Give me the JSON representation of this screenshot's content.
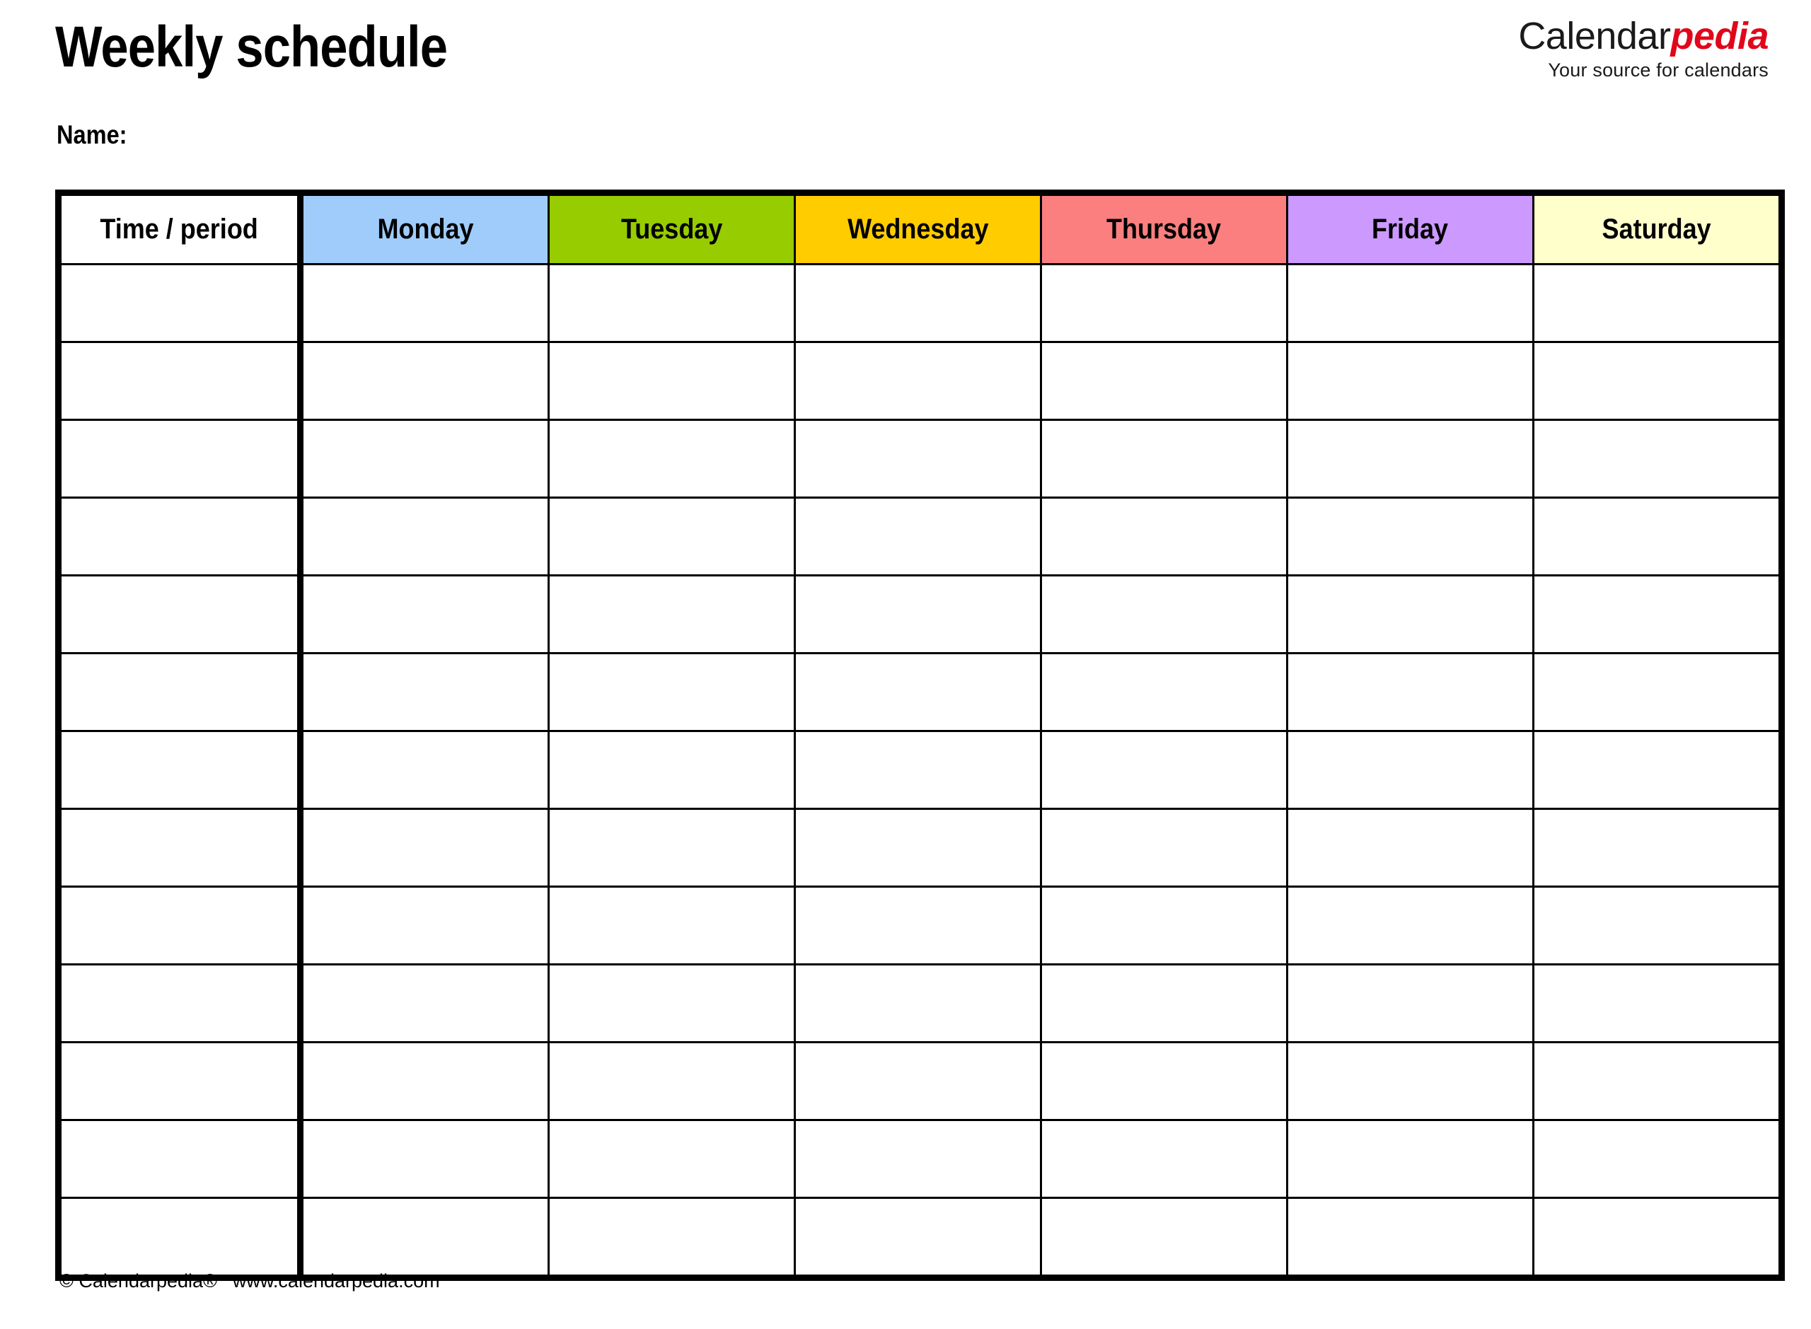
{
  "document": {
    "title": "Weekly schedule",
    "name_label": "Name:"
  },
  "brand": {
    "word_part1": "Calendar",
    "word_part2": "pedia",
    "tagline": "Your source for calendars",
    "accent_color": "#e1071b"
  },
  "table": {
    "columns": [
      {
        "label": "Time / period",
        "bg": "#ffffff",
        "key": "time"
      },
      {
        "label": "Monday",
        "bg": "#9fccfa",
        "key": "monday"
      },
      {
        "label": "Tuesday",
        "bg": "#97cc00",
        "key": "tuesday"
      },
      {
        "label": "Wednesday",
        "bg": "#ffcc00",
        "key": "wednesday"
      },
      {
        "label": "Thursday",
        "bg": "#fb7f7f",
        "key": "thursday"
      },
      {
        "label": "Friday",
        "bg": "#cc99ff",
        "key": "friday"
      },
      {
        "label": "Saturday",
        "bg": "#ffffcc",
        "key": "saturday"
      }
    ],
    "row_count": 13,
    "rows": [
      {
        "time": "",
        "monday": "",
        "tuesday": "",
        "wednesday": "",
        "thursday": "",
        "friday": "",
        "saturday": ""
      },
      {
        "time": "",
        "monday": "",
        "tuesday": "",
        "wednesday": "",
        "thursday": "",
        "friday": "",
        "saturday": ""
      },
      {
        "time": "",
        "monday": "",
        "tuesday": "",
        "wednesday": "",
        "thursday": "",
        "friday": "",
        "saturday": ""
      },
      {
        "time": "",
        "monday": "",
        "tuesday": "",
        "wednesday": "",
        "thursday": "",
        "friday": "",
        "saturday": ""
      },
      {
        "time": "",
        "monday": "",
        "tuesday": "",
        "wednesday": "",
        "thursday": "",
        "friday": "",
        "saturday": ""
      },
      {
        "time": "",
        "monday": "",
        "tuesday": "",
        "wednesday": "",
        "thursday": "",
        "friday": "",
        "saturday": ""
      },
      {
        "time": "",
        "monday": "",
        "tuesday": "",
        "wednesday": "",
        "thursday": "",
        "friday": "",
        "saturday": ""
      },
      {
        "time": "",
        "monday": "",
        "tuesday": "",
        "wednesday": "",
        "thursday": "",
        "friday": "",
        "saturday": ""
      },
      {
        "time": "",
        "monday": "",
        "tuesday": "",
        "wednesday": "",
        "thursday": "",
        "friday": "",
        "saturday": ""
      },
      {
        "time": "",
        "monday": "",
        "tuesday": "",
        "wednesday": "",
        "thursday": "",
        "friday": "",
        "saturday": ""
      },
      {
        "time": "",
        "monday": "",
        "tuesday": "",
        "wednesday": "",
        "thursday": "",
        "friday": "",
        "saturday": ""
      },
      {
        "time": "",
        "monday": "",
        "tuesday": "",
        "wednesday": "",
        "thursday": "",
        "friday": "",
        "saturday": ""
      },
      {
        "time": "",
        "monday": "",
        "tuesday": "",
        "wednesday": "",
        "thursday": "",
        "friday": "",
        "saturday": ""
      }
    ]
  },
  "footer": {
    "copyright": "© Calendarpedia®",
    "website": "www.calendarpedia.com"
  }
}
